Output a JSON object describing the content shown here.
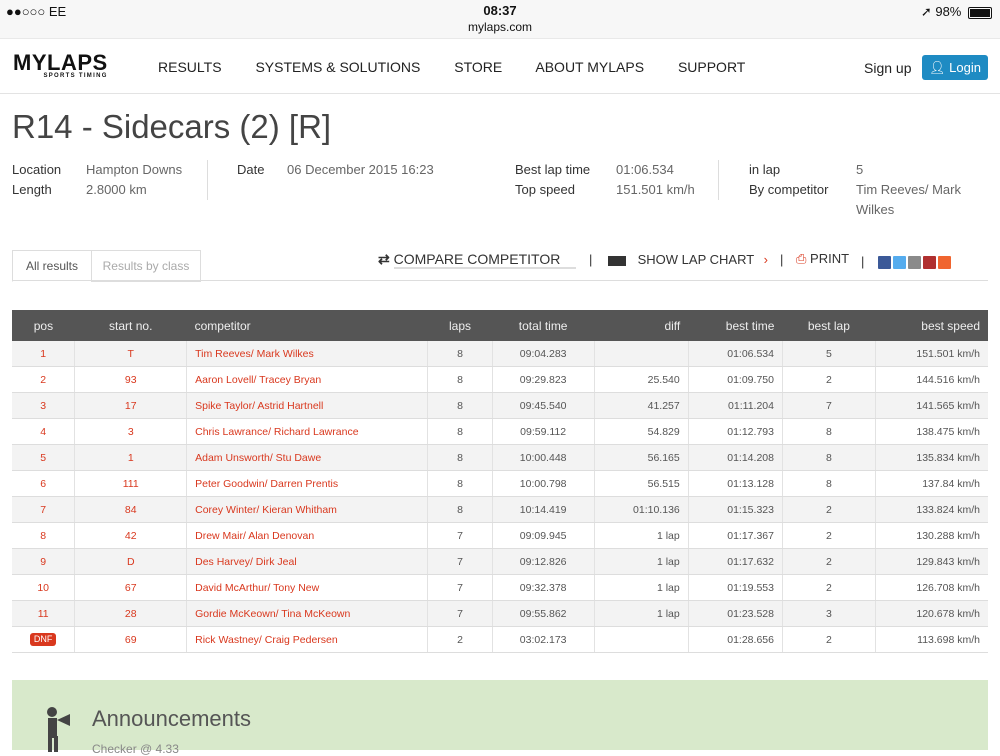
{
  "status_bar": {
    "carrier": "●●○○○ EE",
    "time": "08:37",
    "url": "mylaps.com",
    "battery": "98%"
  },
  "header": {
    "logo": "MYLAPS",
    "logo_sub": "SPORTS TIMING",
    "nav": [
      "RESULTS",
      "SYSTEMS & SOLUTIONS",
      "STORE",
      "ABOUT MYLAPS",
      "SUPPORT"
    ],
    "signup": "Sign up",
    "login": "Login"
  },
  "title": "R14 - Sidecars (2) [R]",
  "info": {
    "location_label": "Location",
    "location": "Hampton Downs",
    "length_label": "Length",
    "length": "2.8000 km",
    "date_label": "Date",
    "date": "06 December 2015 16:23",
    "best_lap_label": "Best lap time",
    "best_lap": "01:06.534",
    "top_speed_label": "Top speed",
    "top_speed": "151.501 km/h",
    "in_lap_label": "in lap",
    "in_lap": "5",
    "by_label": "By competitor",
    "by": "Tim Reeves/ Mark Wilkes"
  },
  "tabs": {
    "all": "All results",
    "by_class": "Results by class"
  },
  "tools": {
    "compare": "COMPARE COMPETITOR",
    "lap_chart": "SHOW LAP CHART",
    "print": "PRINT"
  },
  "table": {
    "headers": [
      "pos",
      "start no.",
      "competitor",
      "laps",
      "total time",
      "diff",
      "best time",
      "best lap",
      "best speed"
    ],
    "rows": [
      [
        "1",
        "T",
        "Tim Reeves/ Mark Wilkes",
        "8",
        "09:04.283",
        "",
        "01:06.534",
        "5",
        "151.501 km/h"
      ],
      [
        "2",
        "93",
        "Aaron Lovell/ Tracey Bryan",
        "8",
        "09:29.823",
        "25.540",
        "01:09.750",
        "2",
        "144.516 km/h"
      ],
      [
        "3",
        "17",
        "Spike Taylor/ Astrid Hartnell",
        "8",
        "09:45.540",
        "41.257",
        "01:11.204",
        "7",
        "141.565 km/h"
      ],
      [
        "4",
        "3",
        "Chris Lawrance/ Richard Lawrance",
        "8",
        "09:59.112",
        "54.829",
        "01:12.793",
        "8",
        "138.475 km/h"
      ],
      [
        "5",
        "1",
        "Adam Unsworth/ Stu Dawe",
        "8",
        "10:00.448",
        "56.165",
        "01:14.208",
        "8",
        "135.834 km/h"
      ],
      [
        "6",
        "111",
        "Peter Goodwin/ Darren Prentis",
        "8",
        "10:00.798",
        "56.515",
        "01:13.128",
        "8",
        "137.84 km/h"
      ],
      [
        "7",
        "84",
        "Corey Winter/ Kieran Whitham",
        "8",
        "10:14.419",
        "01:10.136",
        "01:15.323",
        "2",
        "133.824 km/h"
      ],
      [
        "8",
        "42",
        "Drew Mair/ Alan Denovan",
        "7",
        "09:09.945",
        "1 lap",
        "01:17.367",
        "2",
        "130.288 km/h"
      ],
      [
        "9",
        "D",
        "Des Harvey/ Dirk Jeal",
        "7",
        "09:12.826",
        "1 lap",
        "01:17.632",
        "2",
        "129.843 km/h"
      ],
      [
        "10",
        "67",
        "David McArthur/ Tony New",
        "7",
        "09:32.378",
        "1 lap",
        "01:19.553",
        "2",
        "126.708 km/h"
      ],
      [
        "11",
        "28",
        "Gordie McKeown/ Tina McKeown",
        "7",
        "09:55.862",
        "1 lap",
        "01:23.528",
        "3",
        "120.678 km/h"
      ],
      [
        "DNF",
        "69",
        "Rick Wastney/ Craig Pedersen",
        "2",
        "03:02.173",
        "",
        "01:28.656",
        "2",
        "113.698 km/h"
      ]
    ]
  },
  "announcements": {
    "title": "Announcements",
    "first": "Checker @ 4.33"
  },
  "colors": {
    "accent_red": "#d9381e",
    "login_blue": "#1e8bc3",
    "header_dark": "#555555",
    "announce_green": "#d8e9cb"
  }
}
